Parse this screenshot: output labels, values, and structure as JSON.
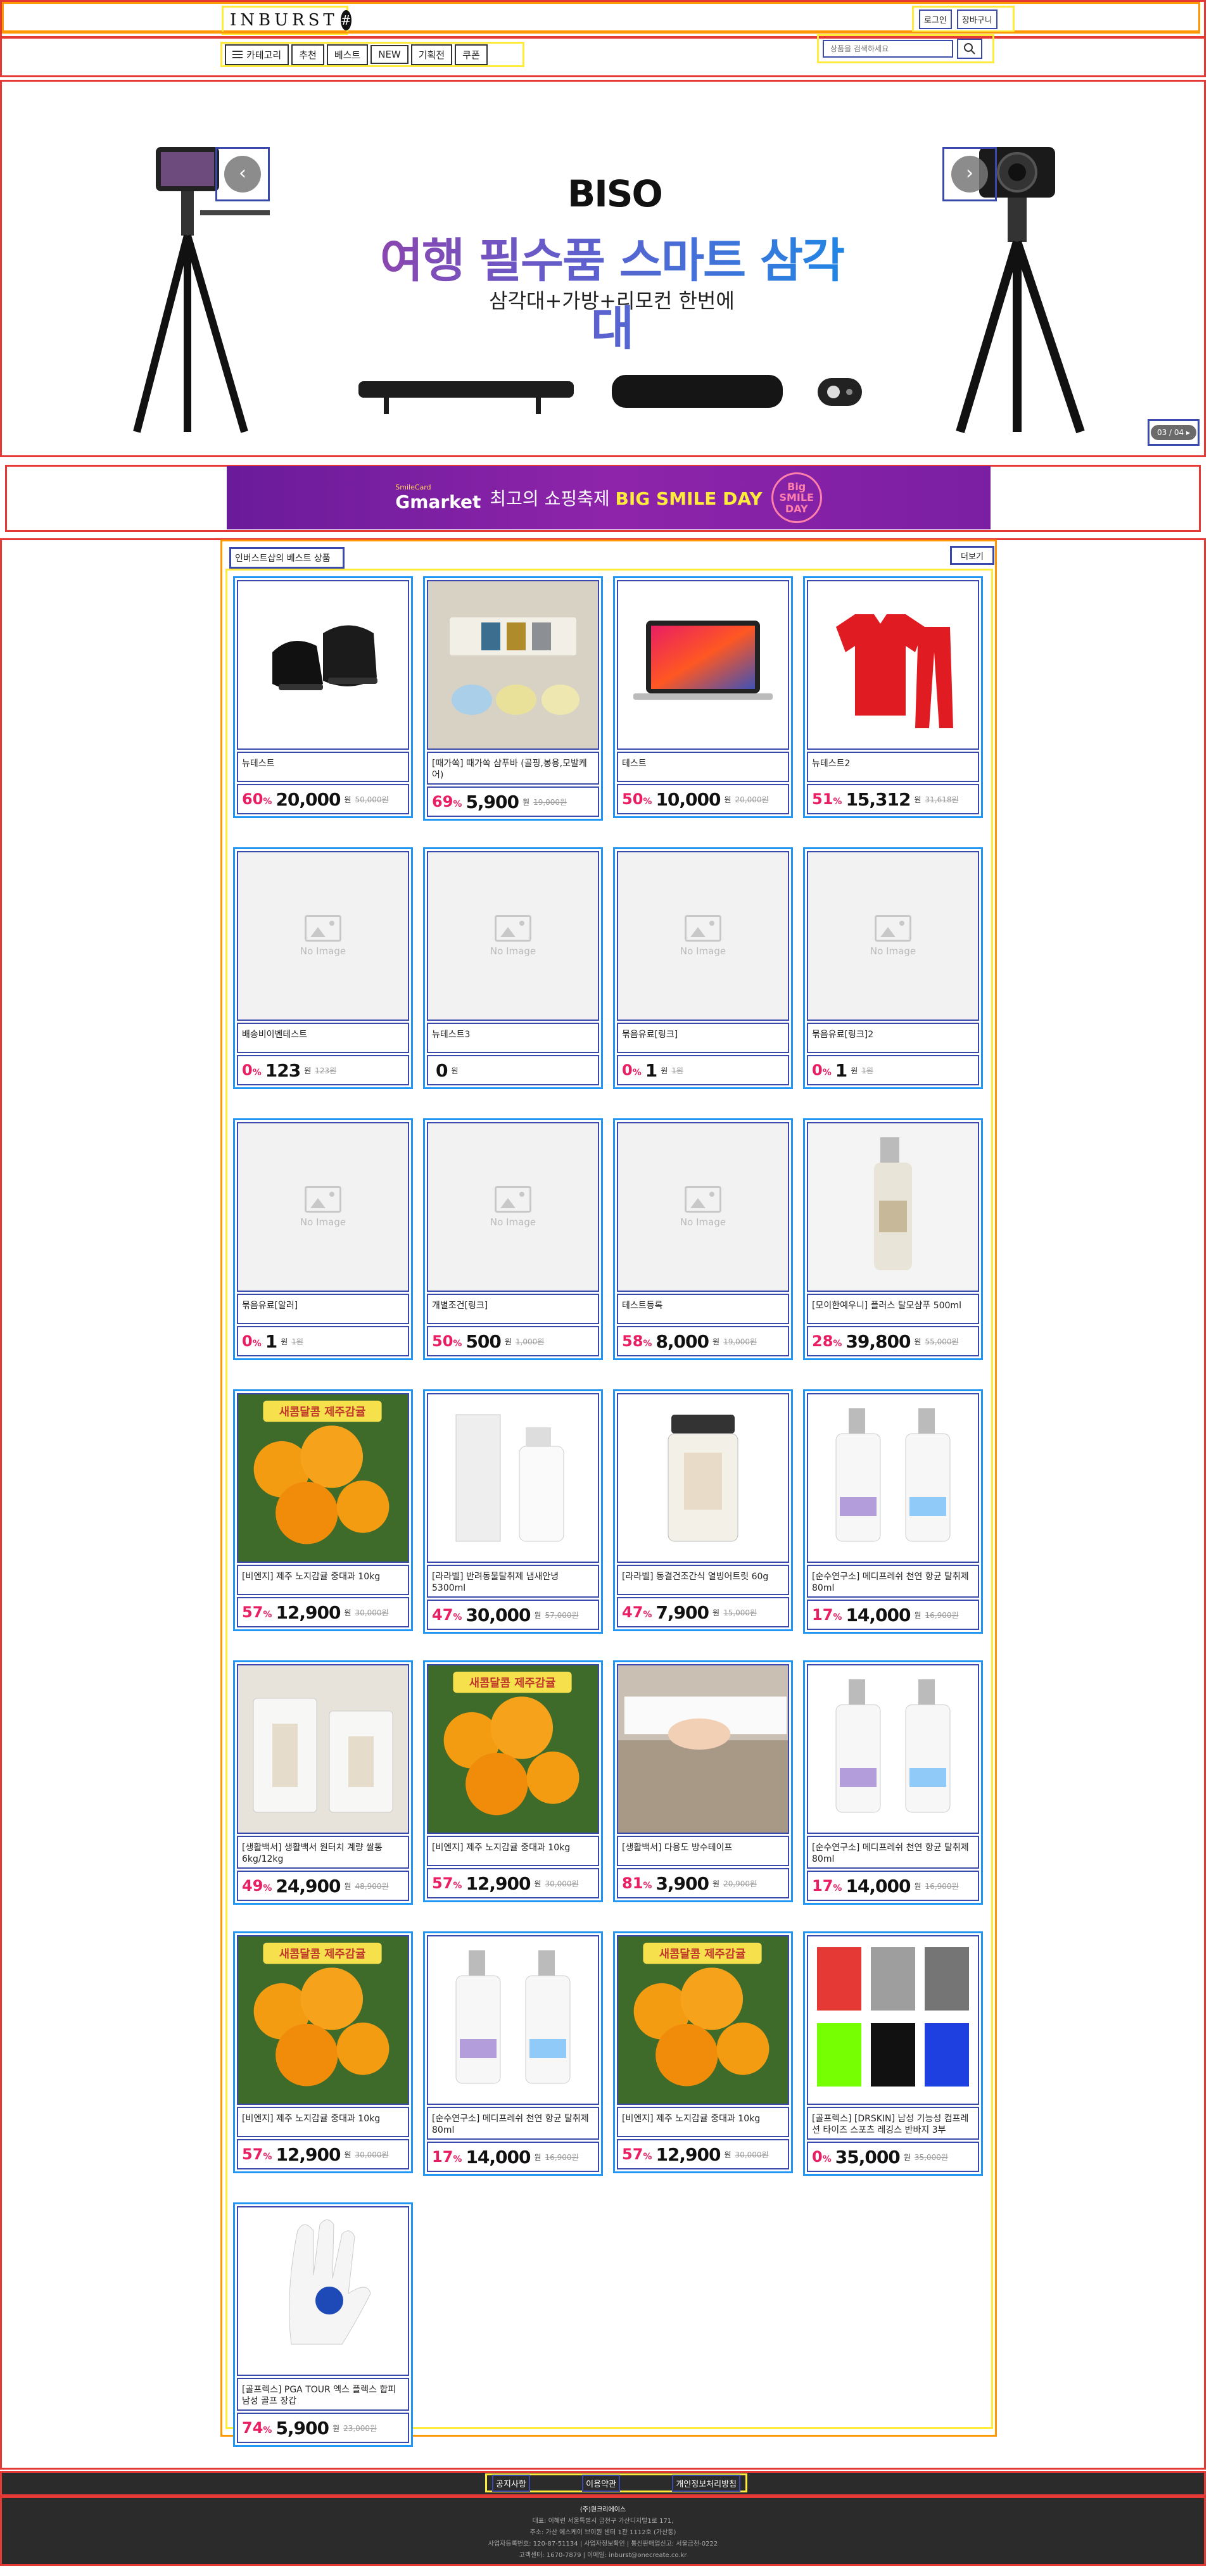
{
  "header": {
    "logo_text": "INBURST",
    "logo_mark": "#",
    "login_label": "로그인",
    "cart_label": "장바구니",
    "nav": {
      "category_label": "카테고리",
      "items": [
        "추천",
        "베스트",
        "NEW",
        "기획전",
        "쿠폰"
      ]
    },
    "search_placeholder": "상품을 검색하세요"
  },
  "banner": {
    "brand": "BISO",
    "title": "여행 필수품 스마트 삼각대",
    "subtitle": "삼각대+가방+리모컨 한번에",
    "pager": "03 / 04 ▸"
  },
  "ad": {
    "brand": "Gmarket",
    "brand_tag": "SmileCard",
    "text_prefix": "최고의 쇼핑축제",
    "text_highlight": "BIG SMILE DAY",
    "badge": "Big SMILE DAY"
  },
  "section": {
    "title": "인버스트샵의 베스트 상품",
    "more_label": "더보기"
  },
  "colors": {
    "accent": "#e91e63",
    "frame_red": "#e53935",
    "frame_blue": "#2196f3"
  },
  "products": [
    {
      "thumb": "shoe",
      "name": "뉴테스트",
      "rate": "60",
      "unit": "%",
      "price": "20,000",
      "won": "원",
      "orig": "50,000원"
    },
    {
      "thumb": "soap",
      "name": "[때가쏙] 때가쏙 샴푸바 (골핑,봉용,모발케어)",
      "rate": "69",
      "unit": "%",
      "price": "5,900",
      "won": "원",
      "orig": "19,000원"
    },
    {
      "thumb": "laptop",
      "name": "테스트",
      "rate": "50",
      "unit": "%",
      "price": "10,000",
      "won": "원",
      "orig": "20,000원"
    },
    {
      "thumb": "jersey",
      "name": "뉴테스트2",
      "rate": "51",
      "unit": "%",
      "price": "15,312",
      "won": "원",
      "orig": "31,618원"
    },
    {
      "thumb": "none",
      "name": "배송비이벤테스트",
      "rate": "0",
      "unit": "%",
      "price": "123",
      "won": "원",
      "orig": "123원"
    },
    {
      "thumb": "none",
      "name": "뉴테스트3",
      "rate": "",
      "unit": "",
      "price": "0",
      "won": "원",
      "orig": ""
    },
    {
      "thumb": "none",
      "name": "묶음유료[링크]",
      "rate": "0",
      "unit": "%",
      "price": "1",
      "won": "원",
      "orig": "1원"
    },
    {
      "thumb": "none",
      "name": "묶음유료[링크]2",
      "rate": "0",
      "unit": "%",
      "price": "1",
      "won": "원",
      "orig": "1원"
    },
    {
      "thumb": "none",
      "name": "묶음유료[알러]",
      "rate": "0",
      "unit": "%",
      "price": "1",
      "won": "원",
      "orig": "1원"
    },
    {
      "thumb": "none",
      "name": "개별조건[링크]",
      "rate": "50",
      "unit": "%",
      "price": "500",
      "won": "원",
      "orig": "1,000원"
    },
    {
      "thumb": "none",
      "name": "테스트등록",
      "rate": "58",
      "unit": "%",
      "price": "8,000",
      "won": "원",
      "orig": "19,000원"
    },
    {
      "thumb": "bottle",
      "name": "[모이한예우니] 플러스 탈모샴푸 500ml",
      "rate": "28",
      "unit": "%",
      "price": "39,800",
      "won": "원",
      "orig": "55,000원"
    },
    {
      "thumb": "orange",
      "name": "[비엔지] 제주 노지감귤 중대과 10kg",
      "rate": "57",
      "unit": "%",
      "price": "12,900",
      "won": "원",
      "orig": "30,000원"
    },
    {
      "thumb": "spray",
      "name": "[라라벨] 반려동물탈취제 냄새안녕 5300ml",
      "rate": "47",
      "unit": "%",
      "price": "30,000",
      "won": "원",
      "orig": "57,000원"
    },
    {
      "thumb": "jar",
      "name": "[라라벨] 동결건조간식 열빙어트릿 60g",
      "rate": "47",
      "unit": "%",
      "price": "7,900",
      "won": "원",
      "orig": "15,000원"
    },
    {
      "thumb": "clear",
      "name": "[순수연구소] 메디프레쉬 천연 항균 탈취제 80ml",
      "rate": "17",
      "unit": "%",
      "price": "14,000",
      "won": "원",
      "orig": "16,900원"
    },
    {
      "thumb": "rice",
      "name": "[생활백서] 생활백서 원터치 계량 쌀통 6kg/12kg",
      "rate": "49",
      "unit": "%",
      "price": "24,900",
      "won": "원",
      "orig": "48,900원"
    },
    {
      "thumb": "orange",
      "name": "[비엔지] 제주 노지감귤 중대과 10kg",
      "rate": "57",
      "unit": "%",
      "price": "12,900",
      "won": "원",
      "orig": "30,000원"
    },
    {
      "thumb": "tape",
      "name": "[생활백서] 다용도 방수테이프",
      "rate": "81",
      "unit": "%",
      "price": "3,900",
      "won": "원",
      "orig": "20,900원"
    },
    {
      "thumb": "clear",
      "name": "[순수연구소] 메디프레쉬 천연 항균 탈취제 80ml",
      "rate": "17",
      "unit": "%",
      "price": "14,000",
      "won": "원",
      "orig": "16,900원"
    },
    {
      "thumb": "orange",
      "name": "[비엔지] 제주 노지감귤 중대과 10kg",
      "rate": "57",
      "unit": "%",
      "price": "12,900",
      "won": "원",
      "orig": "30,000원"
    },
    {
      "thumb": "clear",
      "name": "[순수연구소] 메디프레쉬 천연 항균 탈취제 80ml",
      "rate": "17",
      "unit": "%",
      "price": "14,000",
      "won": "원",
      "orig": "16,900원"
    },
    {
      "thumb": "orange",
      "name": "[비엔지] 제주 노지감귤 중대과 10kg",
      "rate": "57",
      "unit": "%",
      "price": "12,900",
      "won": "원",
      "orig": "30,000원"
    },
    {
      "thumb": "shorts",
      "name": "[골프렉스] [DRSKIN] 남성 기능성 컴프레션 타이즈 스포츠 레깅스 반바지 3부",
      "rate": "0",
      "unit": "%",
      "price": "35,000",
      "won": "원",
      "orig": "35,000원"
    },
    {
      "thumb": "glove",
      "name": "[골프렉스] PGA TOUR 엑스 플렉스 합피 남성 골프 장갑",
      "rate": "74",
      "unit": "%",
      "price": "5,900",
      "won": "원",
      "orig": "23,000원"
    }
  ],
  "no_image_label": "No Image",
  "orange_caption": "새콤달콤 제주감귤",
  "footer": {
    "links": [
      "공지사항",
      "이용약관",
      "개인정보처리방침"
    ],
    "company": "(주)원크리에이스",
    "lines": [
      "대표: 이혜련 서울특별시 금천구 가산디지털1로 171,",
      "주소: 가산 에스케이 브이원 센터 1관 1112호 (가산동)",
      "사업자등록번호: 120-87-51134 | 사업자정보확인 | 통신판매업신고: 서울금천-0222",
      "고객센터: 1670-7879 | 이메일: inburst@onecreate.co.kr"
    ]
  }
}
